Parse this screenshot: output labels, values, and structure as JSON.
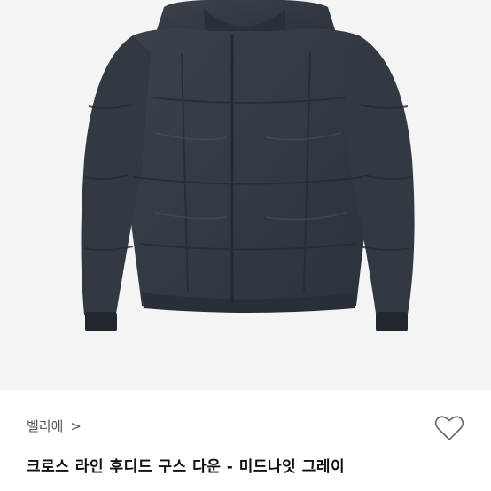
{
  "product": {
    "brand": "벨리에",
    "brand_chevron": ">",
    "title": "크로스 라인 후디드 구스 다운 - 미드나잇 그레이",
    "image_icon": "puffer-jacket-photo",
    "wishlist_icon": "heart-outline-icon"
  },
  "colors": {
    "background": "#ffffff",
    "image_background": "#f4f4f4",
    "jacket": "#353c46",
    "title_text": "#111111",
    "brand_text": "#555555"
  }
}
